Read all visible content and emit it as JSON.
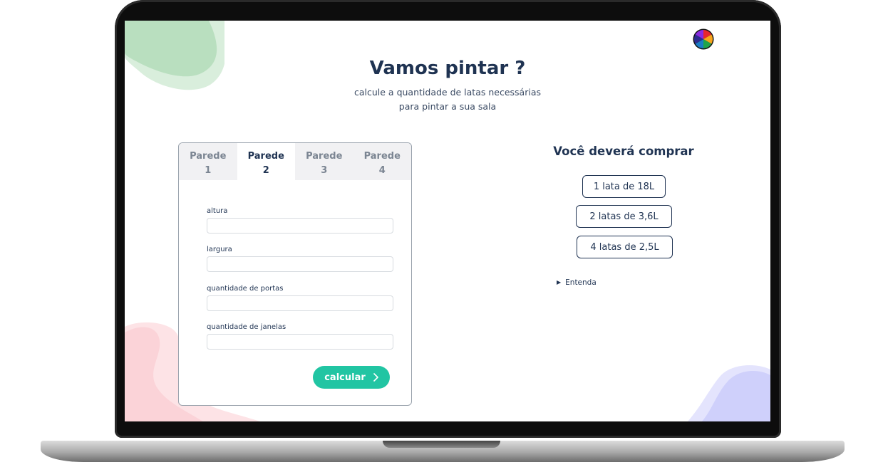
{
  "header": {
    "title": "Vamos pintar ?",
    "subtitle_line1": "calcule a quantidade de latas necessárias",
    "subtitle_line2": "para pintar a sua sala"
  },
  "tabs": [
    {
      "line1": "Parede",
      "line2": "1",
      "active": false
    },
    {
      "line1": "Parede",
      "line2": "2",
      "active": true
    },
    {
      "line1": "Parede",
      "line2": "3",
      "active": false
    },
    {
      "line1": "Parede",
      "line2": "4",
      "active": false
    }
  ],
  "form": {
    "altura_label": "altura",
    "altura_value": "",
    "largura_label": "largura",
    "largura_value": "",
    "portas_label": "quantidade de portas",
    "portas_value": "",
    "janelas_label": "quantidade de janelas",
    "janelas_value": "",
    "submit_label": "calcular",
    "submit_icon": "chevron-right-icon"
  },
  "result": {
    "title": "Você deverá comprar",
    "items": [
      "1 lata de 18L",
      "2 latas de 3,6L",
      "4 latas de 2,5L"
    ],
    "details_label": "Entenda"
  },
  "colors": {
    "primary_text": "#1f3352",
    "accent_button": "#21c5a3",
    "blob_green": "#b9dfbf",
    "blob_pink": "#fbd3d8",
    "blob_lavender": "#cfd0fb",
    "logo_segments": [
      "#e8262d",
      "#f7a51c",
      "#20a44a",
      "#1a7dc4",
      "#2d2b8f",
      "#111111"
    ]
  }
}
